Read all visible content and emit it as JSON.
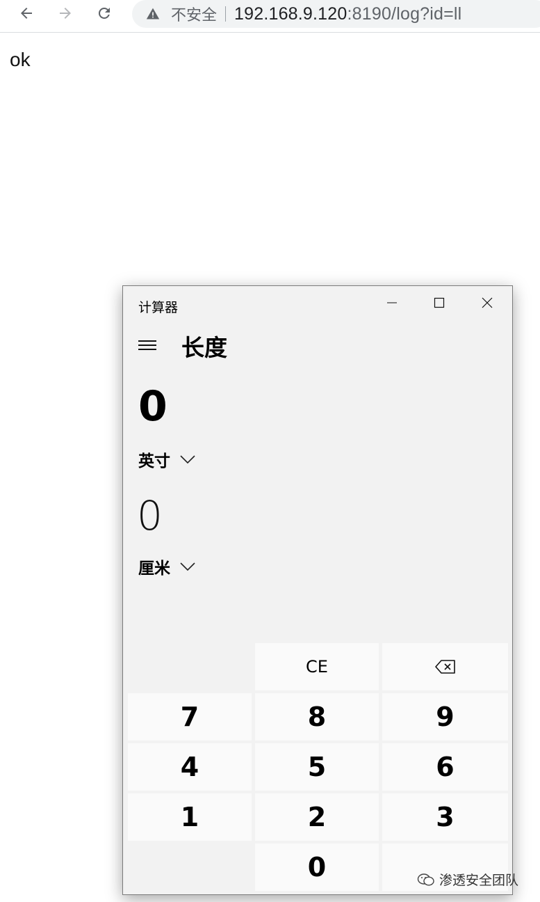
{
  "browser": {
    "insecure_label": "不安全",
    "url_host": "192.168.9.120",
    "url_rest": ":8190/log?id=ll"
  },
  "page": {
    "body_text": "ok"
  },
  "calculator": {
    "window_title": "计算器",
    "mode_title": "长度",
    "input_value": "0",
    "input_unit": "英寸",
    "output_value": "0",
    "output_unit": "厘米",
    "keys": {
      "ce": "CE",
      "k7": "7",
      "k8": "8",
      "k9": "9",
      "k4": "4",
      "k5": "5",
      "k6": "6",
      "k1": "1",
      "k2": "2",
      "k3": "3",
      "k0": "0"
    }
  },
  "watermark": {
    "text": "渗透安全团队"
  }
}
